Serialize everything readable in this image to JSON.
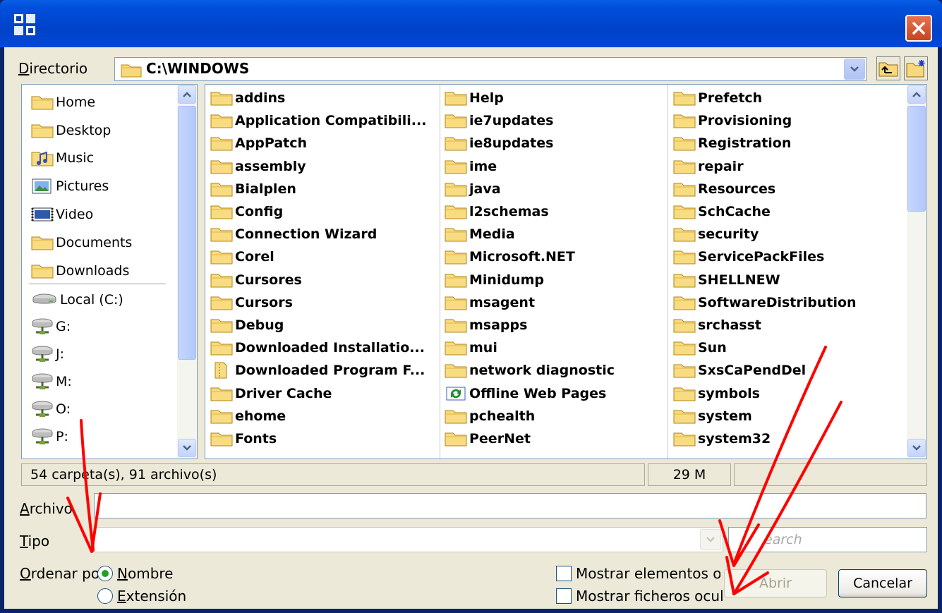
{
  "window": {
    "app_icon": "app-grid-icon",
    "close_icon": "close-icon",
    "accent_color": "#0050dc",
    "close_color": "#d34f2d"
  },
  "directory": {
    "label": "Directorio",
    "path": "C:\\WINDOWS",
    "folder_icon": "folder-icon",
    "dropdown_icon": "chevron-down-icon",
    "up_icon": "up-folder-icon",
    "new_folder_icon": "new-folder-icon"
  },
  "places": [
    {
      "label": "Home",
      "icon": "folder-icon"
    },
    {
      "label": "Desktop",
      "icon": "folder-icon"
    },
    {
      "label": "Music",
      "icon": "music-icon"
    },
    {
      "label": "Pictures",
      "icon": "pictures-icon"
    },
    {
      "label": "Video",
      "icon": "video-icon"
    },
    {
      "label": "Documents",
      "icon": "folder-icon"
    },
    {
      "label": "Downloads",
      "icon": "folder-icon"
    },
    {
      "label": "Local (C:)",
      "icon": "drive-icon"
    },
    {
      "label": "G:",
      "icon": "network-drive-icon"
    },
    {
      "label": "J:",
      "icon": "network-drive-icon"
    },
    {
      "label": "M:",
      "icon": "network-drive-icon"
    },
    {
      "label": "O:",
      "icon": "network-drive-icon"
    },
    {
      "label": "P:",
      "icon": "network-drive-icon"
    }
  ],
  "files": {
    "col1": [
      "addins",
      "Application Compatibili...",
      "AppPatch",
      "assembly",
      "Bialplen",
      "Config",
      "Connection Wizard",
      "Corel",
      "Cursores",
      "Cursors",
      "Debug",
      "Downloaded Installatio...",
      "Downloaded Program F...",
      "Driver Cache",
      "ehome",
      "Fonts"
    ],
    "col2": [
      "Help",
      "ie7updates",
      "ie8updates",
      "ime",
      "java",
      "l2schemas",
      "Media",
      "Microsoft.NET",
      "Minidump",
      "msagent",
      "msapps",
      "mui",
      "network diagnostic",
      "Offline Web Pages",
      "pchealth",
      "PeerNet"
    ],
    "col3": [
      "Prefetch",
      "Provisioning",
      "Registration",
      "repair",
      "Resources",
      "SchCache",
      "security",
      "ServicePackFiles",
      "SHELLNEW",
      "SoftwareDistribution",
      "srchasst",
      "Sun",
      "SxsCaPendDel",
      "symbols",
      "system",
      "system32"
    ]
  },
  "status": {
    "summary": "54 carpeta(s), 91 archivo(s)",
    "size": "29 M",
    "extra": ""
  },
  "archivo": {
    "label": "Archivo",
    "value": ""
  },
  "tipo": {
    "label": "Tipo",
    "value": "",
    "search_placeholder": "earch"
  },
  "sort": {
    "label": "Ordenar po",
    "options": [
      {
        "label": "Nombre",
        "selected": true
      },
      {
        "label": "Extensión",
        "selected": false
      }
    ]
  },
  "options": {
    "show_hidden_elements": "Mostrar elementos ocu",
    "show_hidden_files": "Mostrar ficheros ocult"
  },
  "buttons": {
    "open": "Abrir",
    "cancel": "Cancelar"
  },
  "annotation_color": "#ff0000"
}
